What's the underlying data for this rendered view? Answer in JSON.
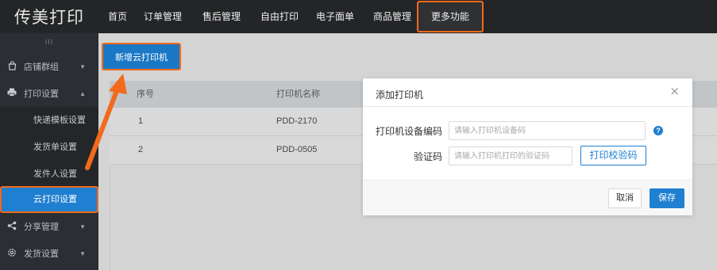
{
  "brand": {
    "logo_text": "传美打印"
  },
  "topnav": {
    "items": [
      "首页",
      "订单管理",
      "售后管理",
      "自由打印",
      "电子面单",
      "商品管理"
    ],
    "more": "更多功能"
  },
  "sidebar": {
    "handle": "III",
    "groups": [
      {
        "label": "店铺群组",
        "icon": "shopping-bag-icon"
      },
      {
        "label": "打印设置",
        "icon": "printer-icon"
      },
      {
        "label": "分享管理",
        "icon": "share-icon"
      },
      {
        "label": "发货设置",
        "icon": "gear-icon"
      }
    ],
    "subitems": [
      "快递模板设置",
      "发货单设置",
      "发件人设置",
      "云打印设置"
    ]
  },
  "main": {
    "add_button": "新增云打印机",
    "table": {
      "headers": [
        "序号",
        "打印机名称"
      ],
      "rows": [
        [
          "1",
          "PDD-2170"
        ],
        [
          "2",
          "PDD-0505"
        ]
      ]
    }
  },
  "modal": {
    "title": "添加打印机",
    "close": "×",
    "device_code_label": "打印机设备编码",
    "device_code_placeholder": "请输入打印机设备码",
    "help": "?",
    "verify_label": "验证码",
    "verify_placeholder": "请输入打印机打印的验证码",
    "verify_button": "打印校验码",
    "cancel": "取消",
    "save": "保存"
  },
  "colors": {
    "accent": "#1f7fd0",
    "highlight": "#f26a1b",
    "nav_bg": "#232527",
    "sidebar_bg": "#2b2f33"
  }
}
